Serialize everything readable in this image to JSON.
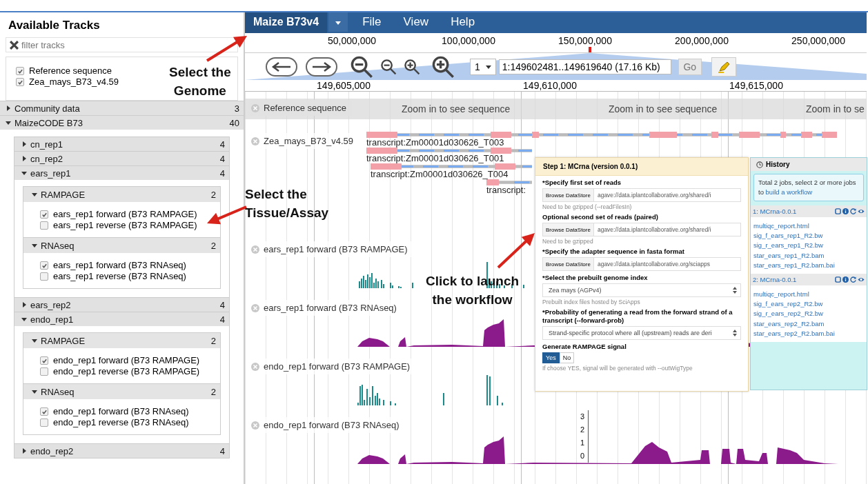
{
  "track_selector": {
    "title": "Available Tracks",
    "filter_placeholder": "filter tracks",
    "tracks": [
      {
        "label": "Reference sequence",
        "checked": true
      },
      {
        "label": "Zea_mays_B73_v4.59",
        "checked": true
      }
    ],
    "categories": [
      {
        "label": "Community data",
        "count": "3",
        "expanded": false
      },
      {
        "label": "MaizeCODE B73",
        "count": "40",
        "expanded": true,
        "children": [
          {
            "label": "cn_rep1",
            "count": "4",
            "expanded": false
          },
          {
            "label": "cn_rep2",
            "count": "4",
            "expanded": false
          },
          {
            "label": "ears_rep1",
            "count": "4",
            "expanded": true,
            "children": [
              {
                "label": "RAMPAGE",
                "count": "2",
                "expanded": true,
                "tracks": [
                  {
                    "label": "ears_rep1 forward (B73 RAMPAGE)",
                    "checked": true
                  },
                  {
                    "label": "ears_rep1 reverse (B73 RAMPAGE)",
                    "checked": false
                  }
                ]
              },
              {
                "label": "RNAseq",
                "count": "2",
                "expanded": true,
                "tracks": [
                  {
                    "label": "ears_rep1 forward (B73 RNAseq)",
                    "checked": true
                  },
                  {
                    "label": "ears_rep1 reverse (B73 RNAseq)",
                    "checked": false
                  }
                ]
              }
            ]
          },
          {
            "label": "ears_rep2",
            "count": "4",
            "expanded": false
          },
          {
            "label": "endo_rep1",
            "count": "4",
            "expanded": true,
            "children": [
              {
                "label": "RAMPAGE",
                "count": "2",
                "expanded": true,
                "tracks": [
                  {
                    "label": "endo_rep1 forward (B73 RAMPAGE)",
                    "checked": true
                  },
                  {
                    "label": "endo_rep1 reverse (B73 RAMPAGE)",
                    "checked": false
                  }
                ]
              },
              {
                "label": "RNAseq",
                "count": "2",
                "expanded": true,
                "tracks": [
                  {
                    "label": "endo_rep1 forward (B73 RNAseq)",
                    "checked": true
                  },
                  {
                    "label": "endo_rep1 reverse (B73 RNAseq)",
                    "checked": false
                  }
                ]
              }
            ]
          },
          {
            "label": "endo_rep2",
            "count": "4",
            "expanded": false
          }
        ]
      }
    ]
  },
  "menu_bar": {
    "genome": "Maize B73v4",
    "menus": [
      "File",
      "View",
      "Help"
    ]
  },
  "overview_ruler": {
    "labels": [
      "50,000,000",
      "100,000,000",
      "150,000,000",
      "200,000,000",
      "250,000,000"
    ]
  },
  "navigation": {
    "chromosome": "1",
    "location": "1:149602481..149619640 (17.16 Kb)",
    "go_button": "Go"
  },
  "detail_ruler": {
    "labels": [
      "149,605,000",
      "149,610,000",
      "149,615,000"
    ]
  },
  "tracks": [
    {
      "kind": "sequence",
      "label": "Reference sequence",
      "messages": [
        "Zoom in to see sequence",
        "Zoom in to see sequence",
        "Zoom in to se"
      ]
    },
    {
      "kind": "genes",
      "label": "Zea_mays_B73_v4.59",
      "transcripts": [
        "transcript:Zm00001d030626_T003",
        "transcript:Zm00001d030626_T001",
        "transcript:Zm00001d030626_T004",
        "transcript:"
      ]
    },
    {
      "kind": "rampage",
      "label": "ears_rep1 forward (B73 RAMPAGE)"
    },
    {
      "kind": "rnaseq",
      "label": "ears_rep1 forward (B73 RNAseq)"
    },
    {
      "kind": "rampage",
      "label": "endo_rep1 forward (B73 RAMPAGE)"
    },
    {
      "kind": "rnaseq",
      "label": "endo_rep1 forward (B73 RNAseq)",
      "y_ticks": [
        "3",
        "2",
        "1",
        "0"
      ]
    }
  ],
  "workflow_form": {
    "title": "Step 1: MCrna (version 0.0.1)",
    "fields": [
      {
        "kind": "file",
        "label": "*Specify first set of reads",
        "button": "Browse DataStore",
        "value": "agave://data.iplantcollaborative.org/shared/i",
        "help": "Need to be gzipped (--readFilesIn)"
      },
      {
        "kind": "file",
        "label": "Optional second set of reads (paired)",
        "button": "Browse DataStore",
        "value": "agave://data.iplantcollaborative.org/shared/i",
        "help": "Need to be gzipped"
      },
      {
        "kind": "file",
        "label": "*Specify the adapter sequence in fasta format",
        "button": "Browse DataStore",
        "value": "agave://data.iplantcollaborative.org/sciapps"
      },
      {
        "kind": "select",
        "label": "*Select the prebuilt genome index",
        "value": "Zea mays (AGPv4)",
        "help": "Prebuilt index files hosted by SciApps"
      },
      {
        "kind": "select",
        "label": "*Probability of generating a read from the forward strand of a transcript (--forward-prob)",
        "value": "Strand-specific protocol where all (upstream) reads are deri"
      },
      {
        "kind": "toggle",
        "label": "Generate RAMPAGE signal",
        "options": [
          {
            "label": "Yes",
            "selected": true
          },
          {
            "label": "No",
            "selected": false
          }
        ],
        "help": "If choose YES, signal will be generated with --outWigType"
      }
    ]
  },
  "history": {
    "title": "History",
    "summary": "Total 2 jobs, select 2 or more jobs to",
    "summary_link": "build a workflow",
    "jobs": [
      {
        "name": "1: MCrna-0.0.1",
        "files": [
          "multiqc_report.html",
          "sig_f_ears_rep1_R2.bw",
          "sig_r_ears_rep1_R2.bw",
          "star_ears_rep1_R2.bam",
          "star_ears_rep1_R2.bam.bai"
        ]
      },
      {
        "name": "2: MCrna-0.0.1",
        "files": [
          "multiqc_report.html",
          "sig_f_ears_rep2_R2.bw",
          "sig_r_ears_rep2_R2.bw",
          "star_ears_rep2_R2.bam",
          "star_ears_rep2_R2.bam.bai"
        ]
      }
    ]
  },
  "annotations": [
    {
      "lines": [
        "Select the",
        "Genome"
      ]
    },
    {
      "lines": [
        "Select the",
        "Tissue/Assay"
      ]
    },
    {
      "lines": [
        "Click to launch",
        "the workflow"
      ]
    }
  ]
}
